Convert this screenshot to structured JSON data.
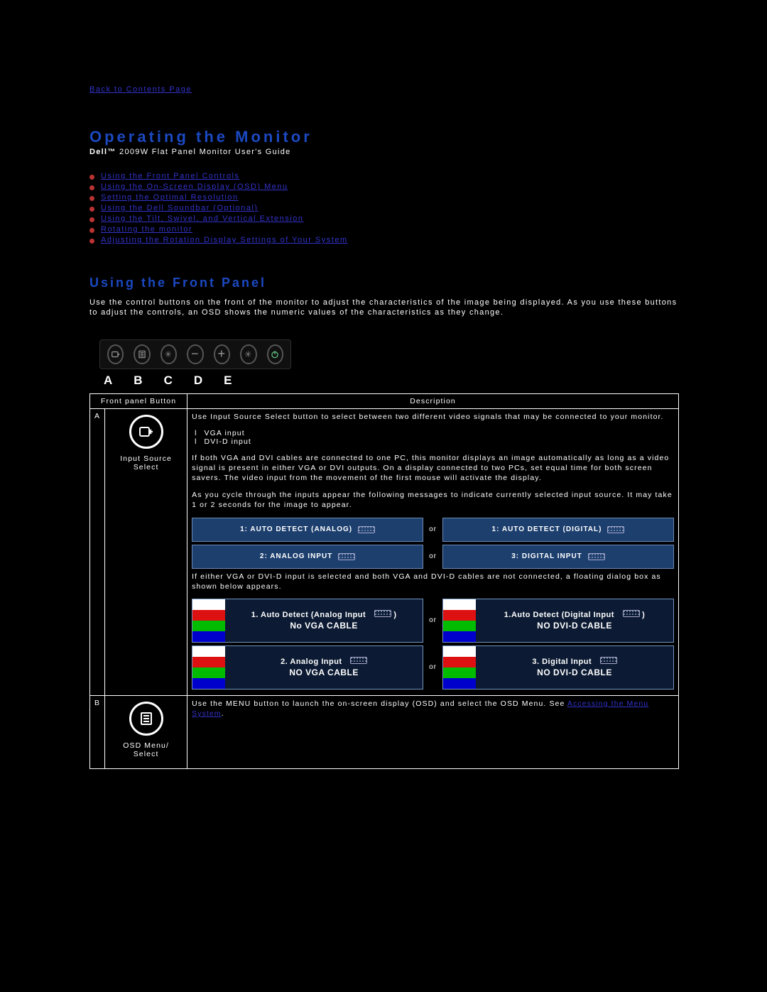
{
  "nav": {
    "back_link": "Back to Contents Page"
  },
  "header": {
    "title": "Operating the Monitor",
    "brand": "Dell™",
    "subtitle_rest": " 2009W Flat Panel Monitor User's Guide"
  },
  "toc": [
    "Using the Front Panel Controls",
    "Using the On-Screen Display (OSD) Menu",
    "Setting the Optimal Resolution",
    "Using the Dell Soundbar (Optional)",
    "Using the Tilt, Swivel, and Vertical Extension",
    "Rotating the monitor",
    "Adjusting the Rotation Display Settings of Your System"
  ],
  "section1": {
    "title": "Using the Front Panel",
    "intro": "Use the control buttons on the front of the monitor to adjust the characteristics of the image being displayed. As you use these buttons to adjust the controls, an OSD shows the numeric values of the characteristics as they change."
  },
  "panel_letters": [
    "A",
    "B",
    "C",
    "D",
    "E"
  ],
  "table": {
    "headers": {
      "col1": "Front panel Button",
      "col2": "Description"
    },
    "rowA": {
      "label": "A",
      "button_caption": "Input Source Select",
      "p1": "Use Input Source Select button to select between two different video signals that may be connected to your monitor.",
      "inputs": [
        "VGA input",
        "DVI-D input"
      ],
      "p2": "If both VGA and DVI cables are connected to one PC, this monitor displays an image automatically as long as a video signal is present in either VGA or DVI outputs. On a display connected to two PCs, set equal time for both screen savers. The video input from the movement of the first mouse will activate the display.",
      "p3": "As you cycle through the inputs appear the following messages to indicate currently selected input source. It may take 1 or 2 seconds for the image to appear.",
      "banners1": {
        "left": "1: AUTO DETECT (ANALOG)",
        "right": "1: AUTO DETECT (DIGITAL)"
      },
      "banners2": {
        "left": "2: ANALOG INPUT",
        "right": "3: DIGITAL INPUT"
      },
      "p4": "If either VGA or DVI-D input is selected and both VGA and DVI-D cables are not connected, a floating dialog box as shown below appears.",
      "nocable1": {
        "left": {
          "line1": "1. Auto Detect (Analog Input",
          "line2": "No VGA CABLE"
        },
        "right": {
          "line1": "1.Auto Detect (Digital  Input",
          "line2": "NO DVI-D CABLE"
        }
      },
      "nocable2": {
        "left": {
          "line1": "2. Analog  Input",
          "line2": "NO VGA CABLE"
        },
        "right": {
          "line1": "3.  Digital  Input",
          "line2": "NO DVI-D CABLE"
        }
      },
      "or": "or"
    },
    "rowB": {
      "label": "B",
      "button_caption": "OSD Menu/ Select",
      "desc_pre": "Use the MENU button to launch the on-screen display (OSD) and select the OSD Menu. See ",
      "desc_link": "Accessing the Menu System",
      "desc_post": "."
    }
  }
}
